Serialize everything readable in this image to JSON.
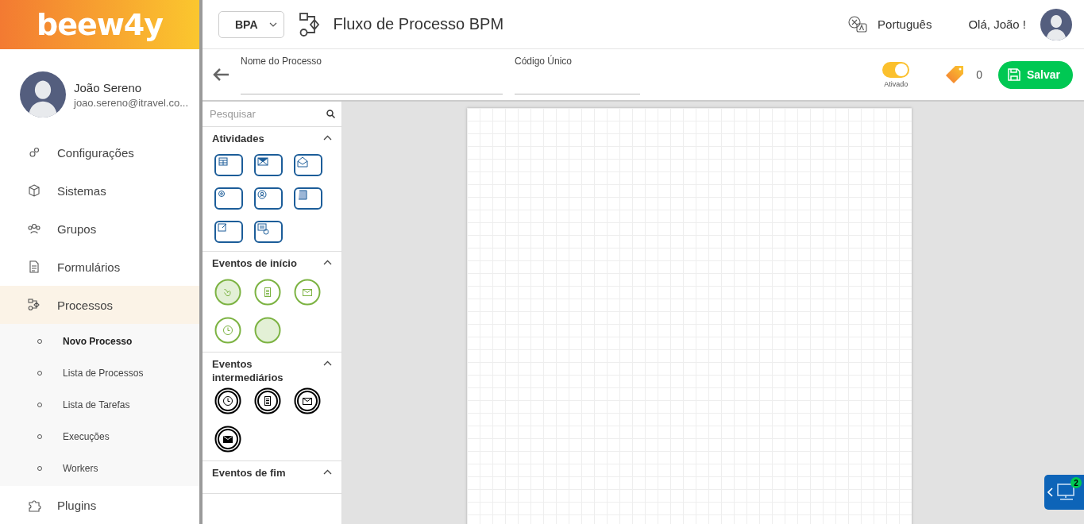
{
  "sidebar": {
    "logo": "beew4y",
    "user": {
      "name": "João Sereno",
      "email": "joao.sereno@itravel.co..."
    },
    "items": [
      {
        "label": "Configurações",
        "kind": "gears",
        "selected": false
      },
      {
        "label": "Sistemas",
        "kind": "cube",
        "selected": false
      },
      {
        "label": "Grupos",
        "kind": "users",
        "selected": false
      },
      {
        "label": "Formulários",
        "kind": "form",
        "selected": false
      },
      {
        "label": "Processos",
        "kind": "flow",
        "selected": true,
        "children": [
          {
            "label": "Novo Processo",
            "selected": true
          },
          {
            "label": "Lista de Processos",
            "selected": false
          },
          {
            "label": "Lista de Tarefas",
            "selected": false
          },
          {
            "label": "Execuções",
            "selected": false
          },
          {
            "label": "Workers",
            "selected": false
          }
        ]
      },
      {
        "label": "Plugins",
        "kind": "puzzle",
        "selected": false
      }
    ]
  },
  "header": {
    "module": "BPA",
    "title": "Fluxo de Processo BPM",
    "language": "Português",
    "greeting": "Olá, João !"
  },
  "form": {
    "fields": [
      {
        "label": "Nome do Processo"
      },
      {
        "label": "Código Único"
      }
    ],
    "toggle": {
      "on": true,
      "label": "Ativado"
    },
    "tag_count": "0",
    "save": "Salvar"
  },
  "palette": {
    "search": {
      "placeholder": "Pesquisar"
    },
    "sections": [
      {
        "title": "Atividades",
        "kind": "activity",
        "expanded": true,
        "items": [
          {
            "kind": "table"
          },
          {
            "kind": "mail-send"
          },
          {
            "kind": "mail-open"
          },
          {
            "kind": "gear"
          },
          {
            "kind": "user"
          },
          {
            "kind": "script"
          },
          {
            "kind": "edit"
          },
          {
            "kind": "service"
          }
        ]
      },
      {
        "title": "Eventos de início",
        "kind": "start",
        "expanded": true,
        "items": [
          {
            "kind": "hand"
          },
          {
            "kind": "document"
          },
          {
            "kind": "mail"
          },
          {
            "kind": "clock"
          },
          {
            "kind": "plain"
          }
        ]
      },
      {
        "title": "Eventos intermediários",
        "kind": "intermediate",
        "expanded": true,
        "items": [
          {
            "kind": "clock"
          },
          {
            "kind": "document"
          },
          {
            "kind": "mail"
          },
          {
            "kind": "mail-filled"
          }
        ]
      },
      {
        "title": "Eventos de fim",
        "expanded": true
      }
    ]
  },
  "widget": {
    "badge": "2"
  }
}
